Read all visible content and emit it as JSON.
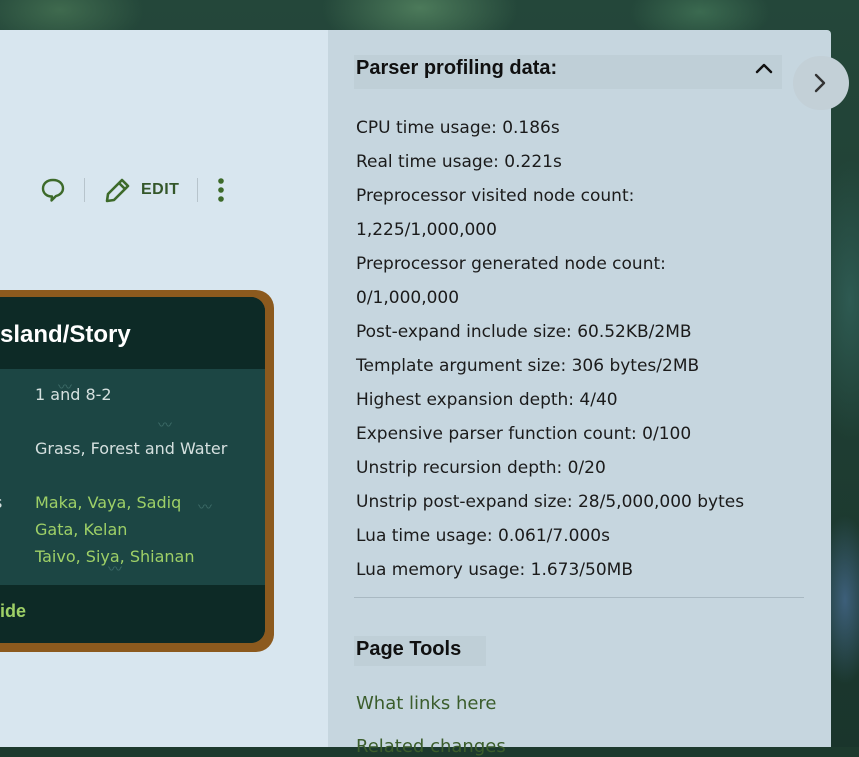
{
  "actions": {
    "edit_label": "EDIT"
  },
  "infobox": {
    "title": "sland/Story",
    "rows": [
      {
        "stub": "",
        "value": "1 and 8-2",
        "color": "plain"
      },
      {
        "stub": "",
        "value": "Grass, Forest and Water",
        "color": "plain"
      },
      {
        "stub": "s",
        "value": "Maka, Vaya, Sadiq",
        "color": "green"
      },
      {
        "stub": "",
        "value": "Gata, Kelan",
        "color": "green"
      },
      {
        "stub": "",
        "value": "Taivo, Siya, Shianan",
        "color": "green"
      }
    ],
    "footer": "ide"
  },
  "profiling": {
    "title": "Parser profiling data:",
    "lines": [
      "CPU time usage: 0.186s",
      "Real time usage: 0.221s",
      "Preprocessor visited node count:",
      "1,225/1,000,000",
      "Preprocessor generated node count:",
      "0/1,000,000",
      "Post-expand include size: 60.52KB/2MB",
      "Template argument size: 306 bytes/2MB",
      "Highest expansion depth: 4/40",
      "Expensive parser function count: 0/100",
      "Unstrip recursion depth: 0/20",
      "Unstrip post-expand size: 28/5,000,000 bytes",
      "Lua time usage: 0.061/7.000s",
      "Lua memory usage: 1.673/50MB"
    ]
  },
  "page_tools": {
    "title": "Page Tools",
    "links": [
      "What links here",
      "Related changes"
    ]
  },
  "colors": {
    "panel_main": "#d8e6ef",
    "panel_side": "#c6d6df",
    "link_green": "#3b5d2c",
    "infobox_bg": "#0f2e2a",
    "infobox_frame": "#8c5a1e",
    "accent_green": "#9ed067"
  }
}
